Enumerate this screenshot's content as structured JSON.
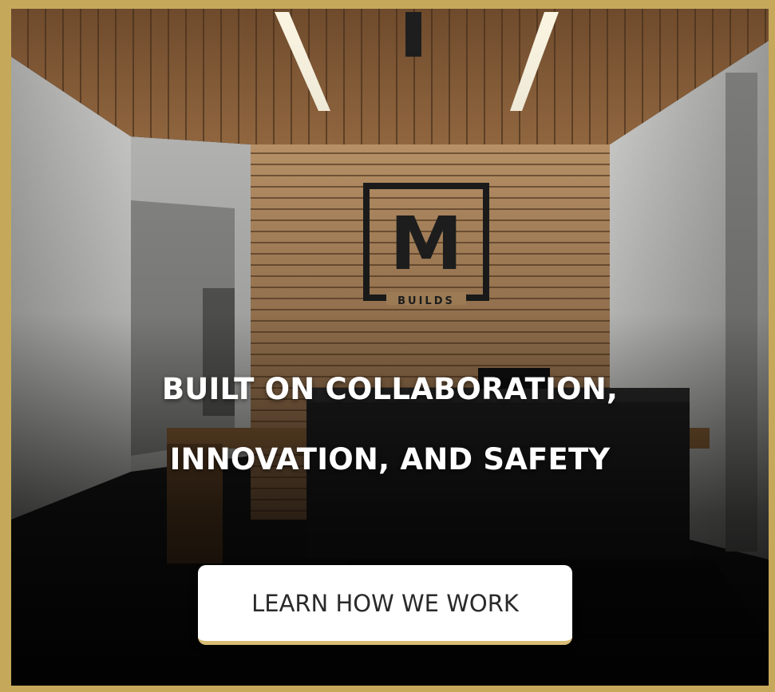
{
  "hero": {
    "headline_line1": "BUILT ON COLLABORATION,",
    "headline_line2": "INNOVATION, AND SAFETY",
    "cta_label": "LEARN HOW WE WORK",
    "logo_letter": "M",
    "logo_word": "BUILDS"
  },
  "colors": {
    "frame_gold": "#c6a85a",
    "cta_underline": "#d8bd77",
    "cta_bg": "#ffffff",
    "text_white": "#ffffff"
  }
}
